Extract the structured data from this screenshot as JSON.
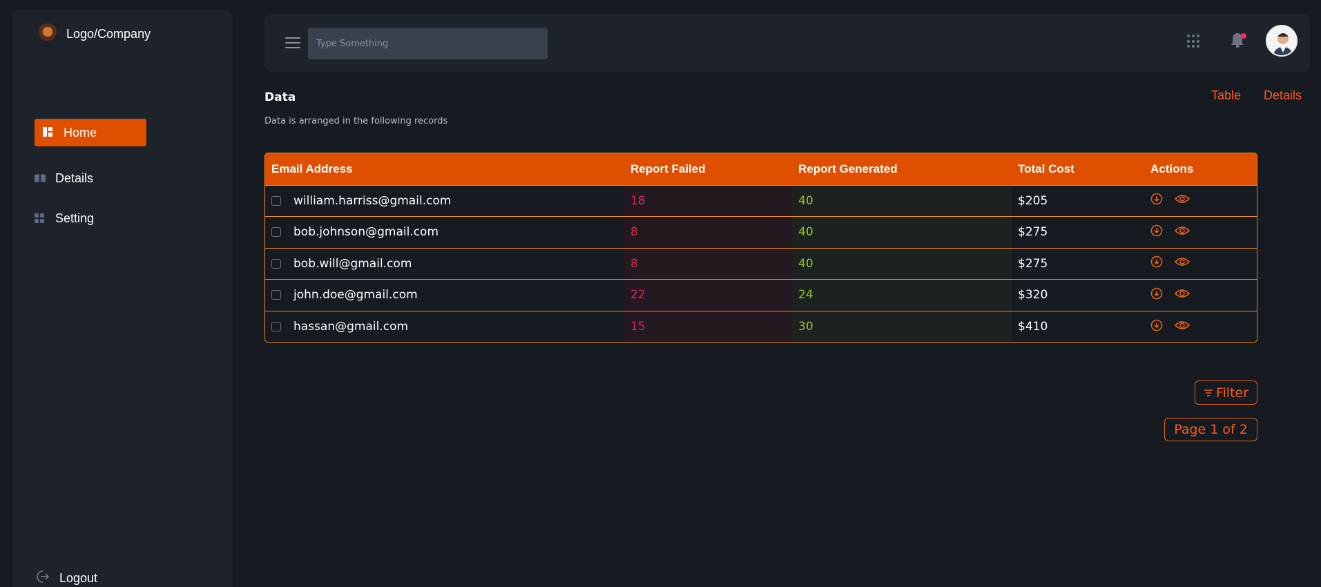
{
  "brand": {
    "name": "Logo/Company"
  },
  "sidebar": {
    "items": [
      {
        "label": "Home",
        "icon": "dashboard-icon"
      },
      {
        "label": "Details",
        "icon": "book-icon"
      },
      {
        "label": "Setting",
        "icon": "grid-icon"
      }
    ],
    "logout_label": "Logout"
  },
  "topbar": {
    "search_placeholder": "Type Something"
  },
  "main": {
    "title": "Data",
    "subtitle": "Data is arranged in the following records",
    "links": [
      "Table",
      "Details"
    ]
  },
  "table": {
    "headers": [
      "Email Address",
      "Report Failed",
      "Report Generated",
      "Total Cost",
      "Actions"
    ],
    "rows": [
      {
        "email": "william.harriss@gmail.com",
        "failed": "18",
        "generated": "40",
        "cost": "$205"
      },
      {
        "email": "bob.johnson@gmail.com",
        "failed": "8",
        "generated": "40",
        "cost": "$275"
      },
      {
        "email": "bob.will@gmail.com",
        "failed": "8",
        "generated": "40",
        "cost": "$275"
      },
      {
        "email": "john.doe@gmail.com",
        "failed": "22",
        "generated": "24",
        "cost": "$320"
      },
      {
        "email": "hassan@gmail.com",
        "failed": "15",
        "generated": "30",
        "cost": "$410"
      }
    ]
  },
  "filter_label": "Filter",
  "pagination": "Page 1 of 2",
  "colors": {
    "accent": "#e04f00",
    "fail": "#e0284a",
    "generated": "#9bc12a",
    "background": "#161a21"
  }
}
